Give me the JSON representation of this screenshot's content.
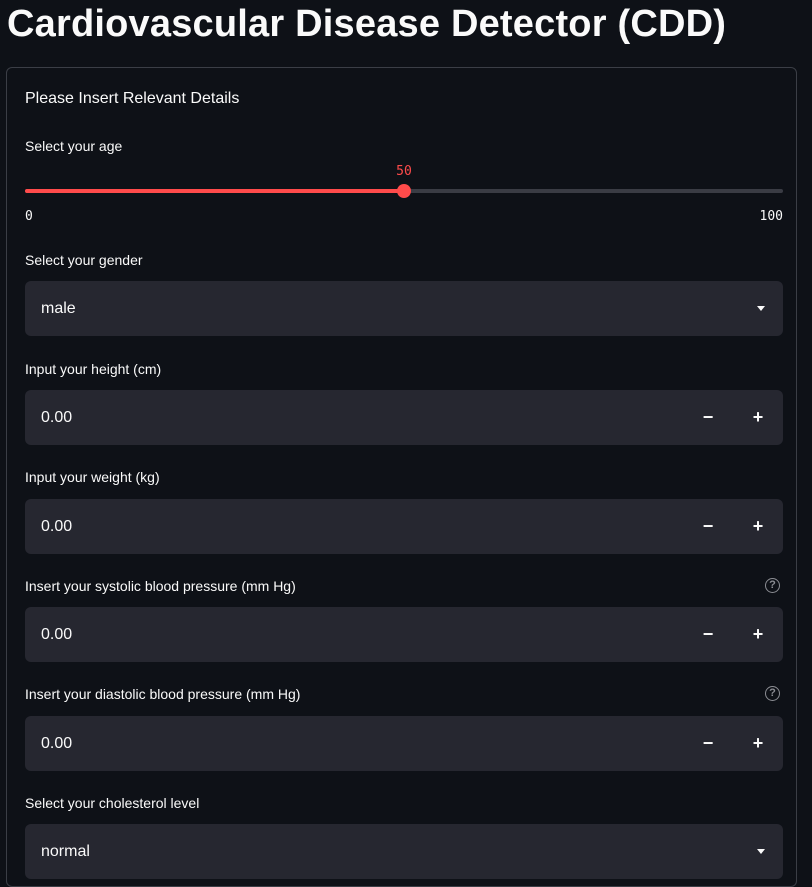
{
  "app": {
    "title": "Cardiovascular Disease Detector (CDD)"
  },
  "form": {
    "heading": "Please Insert Relevant Details",
    "age": {
      "label": "Select your age",
      "value": "50",
      "min": "0",
      "max": "100",
      "fraction": 0.5
    },
    "gender": {
      "label": "Select your gender",
      "value": "male"
    },
    "height": {
      "label": "Input your height (cm)",
      "value": "0.00",
      "minus": "−",
      "plus": "+"
    },
    "weight": {
      "label": "Input your weight (kg)",
      "value": "0.00",
      "minus": "−",
      "plus": "+"
    },
    "systolic": {
      "label": "Insert your systolic blood pressure (mm Hg)",
      "value": "0.00",
      "minus": "−",
      "plus": "+",
      "help": "?"
    },
    "diastolic": {
      "label": "Insert your diastolic blood pressure (mm Hg)",
      "value": "0.00",
      "minus": "−",
      "plus": "+",
      "help": "?"
    },
    "cholesterol": {
      "label": "Select your cholesterol level",
      "value": "normal"
    }
  },
  "colors": {
    "accent": "#ff4b4b",
    "background": "#0e1117",
    "input_bg": "#262730"
  }
}
